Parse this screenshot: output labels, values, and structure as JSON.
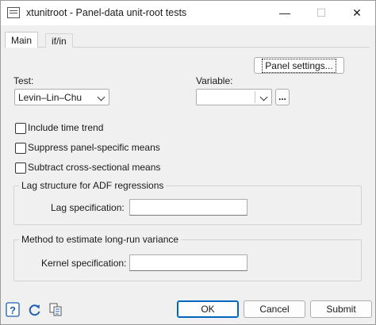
{
  "window": {
    "title": "xtunitroot - Panel-data unit-root tests",
    "minimize_glyph": "—",
    "maximize_glyph": "☐",
    "close_glyph": "✕"
  },
  "tabs": [
    {
      "label": "Main",
      "active": true
    },
    {
      "label": "if/in",
      "active": false
    }
  ],
  "main": {
    "panel_settings_label": "Panel settings...",
    "test_label": "Test:",
    "test_value": "Levin–Lin–Chu",
    "variable_label": "Variable:",
    "variable_value": "",
    "browse_label": "...",
    "checkboxes": [
      {
        "label": "Include time trend",
        "checked": false
      },
      {
        "label": "Suppress panel-specific means",
        "checked": false
      },
      {
        "label": "Subtract cross-sectional means",
        "checked": false
      }
    ],
    "lag_group_title": "Lag structure for ADF regressions",
    "lag_spec_label": "Lag specification:",
    "lag_spec_value": "",
    "lrv_group_title": "Method to estimate long-run variance",
    "kernel_spec_label": "Kernel specification:",
    "kernel_spec_value": ""
  },
  "footer": {
    "help_icon": "help-icon",
    "reset_icon": "reset-icon",
    "copy_icon": "copy-command-icon",
    "ok_label": "OK",
    "cancel_label": "Cancel",
    "submit_label": "Submit"
  },
  "colors": {
    "accent": "#0067c0",
    "help_icon": "#1e5fb4",
    "background": "#f0f0f0"
  }
}
